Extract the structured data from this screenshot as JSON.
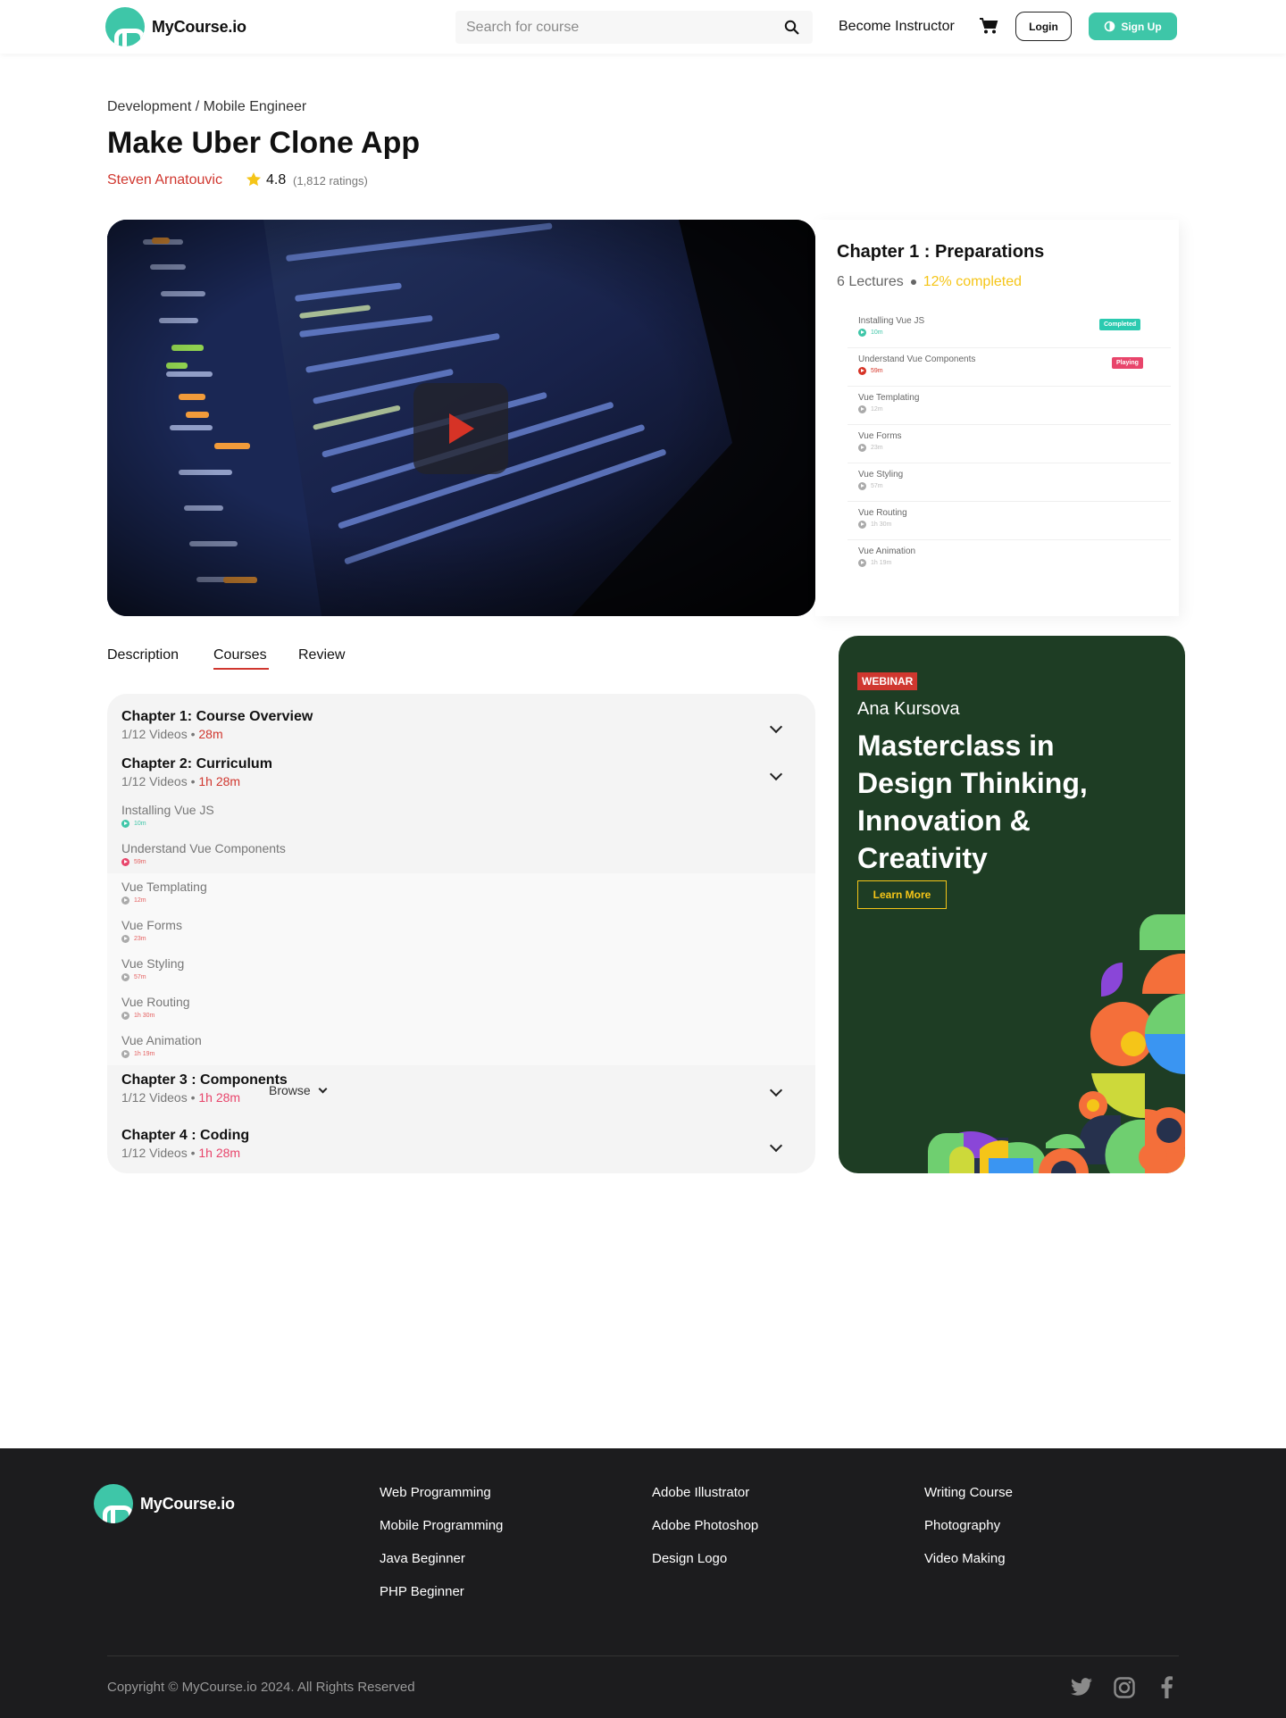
{
  "header": {
    "logo_text": "MyCourse.io",
    "search_placeholder": "Search for course",
    "become_instructor": "Become Instructor",
    "login": "Login",
    "signup": "Sign Up"
  },
  "breadcrumb": "Development / Mobile Engineer",
  "course": {
    "title": "Make Uber Clone App",
    "author": "Steven Arnatouvic",
    "rating": "4.8",
    "ratings_count": "(1,812 ratings)"
  },
  "chapter_panel": {
    "title": "Chapter 1 : Preparations",
    "lectures": "6 Lectures",
    "completed": "12% completed",
    "items": [
      {
        "title": "Installing Vue JS",
        "duration": "10m",
        "badge": "Completed"
      },
      {
        "title": "Understand Vue Components",
        "duration": "59m",
        "badge": "Playing"
      },
      {
        "title": "Vue Templating",
        "duration": "12m",
        "badge": ""
      },
      {
        "title": "Vue Forms",
        "duration": "23m",
        "badge": ""
      },
      {
        "title": "Vue Styling",
        "duration": "57m",
        "badge": ""
      },
      {
        "title": "Vue Routing",
        "duration": "1h 30m",
        "badge": ""
      },
      {
        "title": "Vue Animation",
        "duration": "1h 19m",
        "badge": ""
      }
    ]
  },
  "tabs": [
    "Description",
    "Courses",
    "Review"
  ],
  "accordion": {
    "chapters": [
      {
        "title": "Chapter 1: Course Overview",
        "videos": "1/12 Videos •",
        "time": "28m"
      },
      {
        "title": "Chapter 2: Curriculum",
        "videos": "1/12 Videos •",
        "time": "1h 28m"
      },
      {
        "title": "Chapter 3 : Components",
        "videos": "1/12 Videos •",
        "time": "1h 28m"
      },
      {
        "title": "Chapter 4 : Coding",
        "videos": "1/12 Videos •",
        "time": "1h 28m"
      }
    ],
    "lectures": [
      {
        "title": "Installing Vue JS",
        "duration": "10m"
      },
      {
        "title": "Understand Vue Components",
        "duration": "59m"
      },
      {
        "title": "Vue Templating",
        "duration": "12m"
      },
      {
        "title": "Vue Forms",
        "duration": "23m"
      },
      {
        "title": "Vue Styling",
        "duration": "57m"
      },
      {
        "title": "Vue Routing",
        "duration": "1h 30m"
      },
      {
        "title": "Vue Animation",
        "duration": "1h 19m"
      }
    ],
    "browse": "Browse"
  },
  "webinar": {
    "tag": "WEBINAR",
    "speaker": "Ana Kursova",
    "title": "Masterclass in Design Thinking, Innovation & Creativity",
    "cta": "Learn More"
  },
  "footer": {
    "logo_text": "MyCourse.io",
    "col1": [
      "Web Programming",
      "Mobile Programming",
      "Java Beginner",
      "PHP Beginner"
    ],
    "col2": [
      "Adobe Illustrator",
      "Adobe Photoshop",
      "Design Logo"
    ],
    "col3": [
      "Writing Course",
      "Photography",
      "Video Making"
    ],
    "copyright": "Copyright © MyCourse.io 2024. All Rights Reserved"
  },
  "icons": {
    "search": "search-icon",
    "cart": "cart-icon",
    "star": "star-icon",
    "play": "play-icon",
    "twitter": "twitter-icon",
    "instagram": "instagram-icon",
    "facebook": "facebook-icon"
  },
  "colors": {
    "brand_teal": "#3ec6a8",
    "author_red": "#d0372f",
    "completed_yellow": "#f5c518",
    "playing_pink": "#e8456b",
    "webinar_green": "#1e3d24",
    "footer_dark": "#1c1c1e"
  }
}
